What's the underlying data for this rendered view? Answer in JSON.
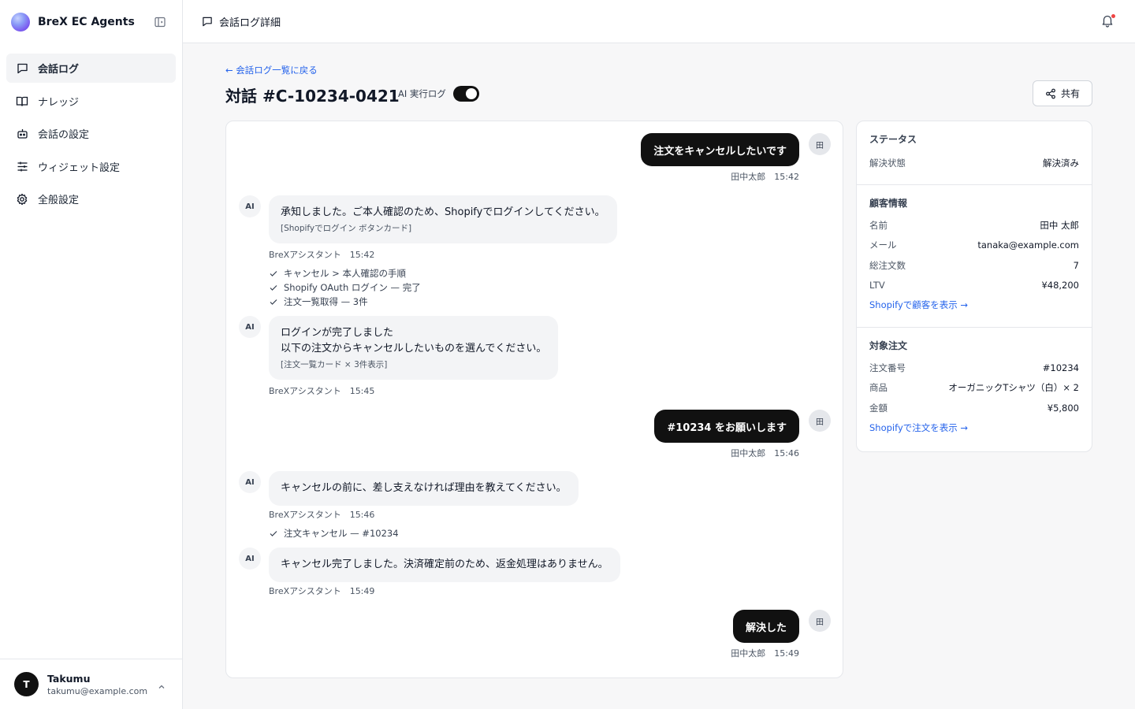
{
  "app": {
    "brand_name": "BreX EC Agents",
    "brand_logo_colors": [
      "#c7d2fe",
      "#8b9cf7",
      "#7c5cf0",
      "#5b3fd6"
    ]
  },
  "sidebar": {
    "items": [
      {
        "label": "会話ログ",
        "icon": "chat-bubble-icon",
        "active": true
      },
      {
        "label": "ナレッジ",
        "icon": "book-icon",
        "active": false
      },
      {
        "label": "会話の設定",
        "icon": "robot-icon",
        "active": false
      },
      {
        "label": "ウィジェット設定",
        "icon": "sliders-icon",
        "active": false
      },
      {
        "label": "全般設定",
        "icon": "gear-icon",
        "active": false
      }
    ],
    "user": {
      "initial": "T",
      "name": "Takumu",
      "email": "takumu@example.com"
    }
  },
  "topbar": {
    "title": "会話ログ詳細"
  },
  "header": {
    "back_link": "← 会話ログ一覧に戻る",
    "title": "対話 #C-10234-0421",
    "ai_log_label": "AI 実行ログ",
    "ai_log_enabled": true,
    "share_label": "共有"
  },
  "chat": {
    "messages": [
      {
        "role": "user",
        "avatar": "田",
        "text": "注文をキャンセルしたいです",
        "meta": "田中太郎　15:42"
      },
      {
        "role": "ai",
        "avatar": "AI",
        "lines": [
          "承知しました。ご本人確認のため、Shopifyでログインしてください。"
        ],
        "note": "[Shopifyでログイン ボタンカード]",
        "meta": "BreXアシスタント　15:42",
        "steps": [
          "キャンセル > 本人確認の手順",
          "Shopify OAuth ログイン — 完了",
          "注文一覧取得 — 3件"
        ]
      },
      {
        "role": "ai",
        "avatar": "AI",
        "lines": [
          "ログインが完了しました",
          "以下の注文からキャンセルしたいものを選んでください。"
        ],
        "note": "[注文一覧カード × 3件表示]",
        "meta": "BreXアシスタント　15:45",
        "steps": []
      },
      {
        "role": "user",
        "avatar": "田",
        "text": "#10234 をお願いします",
        "meta": "田中太郎　15:46"
      },
      {
        "role": "ai",
        "avatar": "AI",
        "lines": [
          "キャンセルの前に、差し支えなければ理由を教えてください。"
        ],
        "note": "",
        "meta": "BreXアシスタント　15:46",
        "steps": [
          "注文キャンセル — #10234"
        ]
      },
      {
        "role": "ai",
        "avatar": "AI",
        "lines": [
          "キャンセル完了しました。決済確定前のため、返金処理はありません。"
        ],
        "note": "",
        "meta": "BreXアシスタント　15:49",
        "steps": []
      },
      {
        "role": "user",
        "avatar": "田",
        "text": "解決した",
        "meta": "田中太郎　15:49"
      }
    ]
  },
  "info": {
    "status": {
      "title": "ステータス",
      "rows": [
        {
          "k": "解決状態",
          "v": "解決済み"
        }
      ]
    },
    "customer": {
      "title": "顧客情報",
      "rows": [
        {
          "k": "名前",
          "v": "田中 太郎"
        },
        {
          "k": "メール",
          "v": "tanaka@example.com"
        },
        {
          "k": "総注文数",
          "v": "7"
        },
        {
          "k": "LTV",
          "v": "¥48,200"
        }
      ],
      "link": "Shopifyで顧客を表示 →"
    },
    "order": {
      "title": "対象注文",
      "rows": [
        {
          "k": "注文番号",
          "v": "#10234"
        },
        {
          "k": "商品",
          "v": "オーガニックTシャツ（白）× 2"
        },
        {
          "k": "金額",
          "v": "¥5,800"
        }
      ],
      "link": "Shopifyで注文を表示 →"
    }
  },
  "colors": {
    "accent": "#2563eb",
    "user_bubble": "#111111",
    "ai_bubble": "#f3f4f6",
    "notification_dot": "#ef4444"
  }
}
